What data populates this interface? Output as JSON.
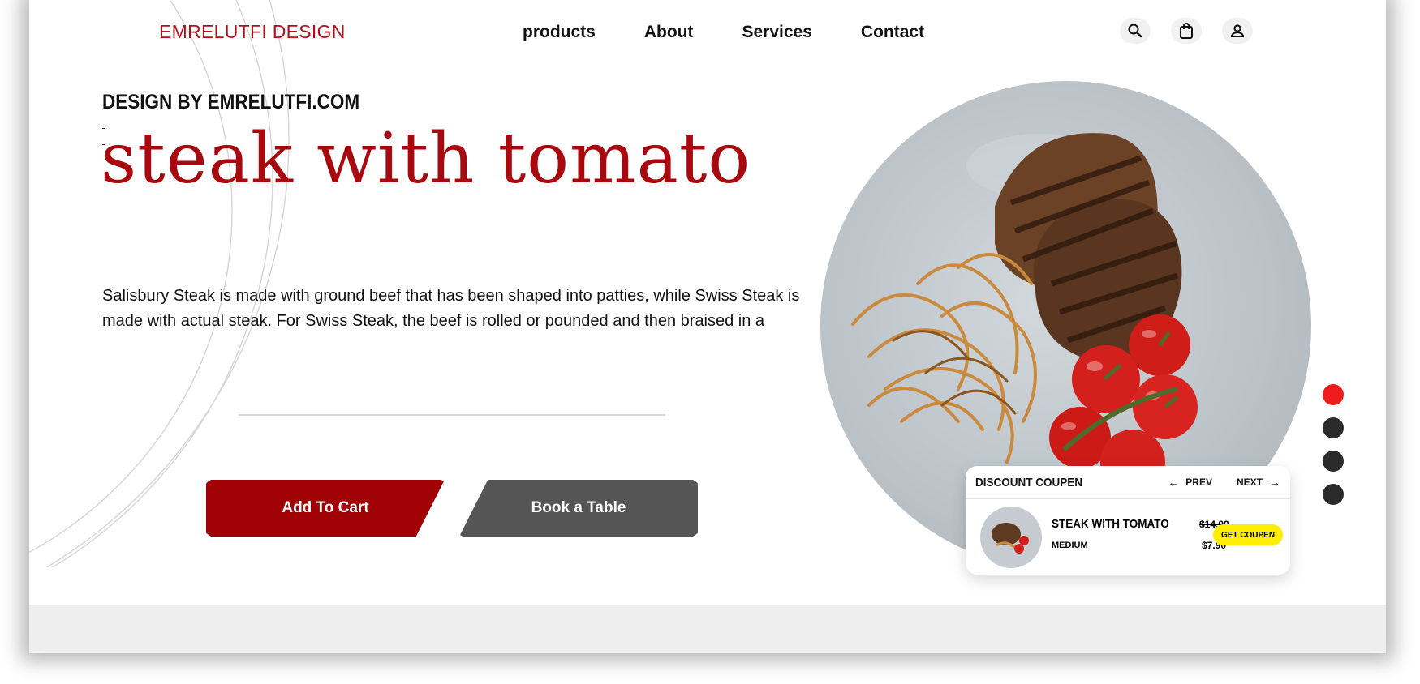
{
  "brand": {
    "logo": "EMRELUTFI DESIGN"
  },
  "nav": {
    "items": [
      "products",
      "About",
      "Services",
      "Contact"
    ]
  },
  "header_icons": [
    "search-icon",
    "bag-icon",
    "user-icon"
  ],
  "hero": {
    "eyebrow": "DESIGN BY EMRELUTFI.COM",
    "title": "steak with tomato",
    "description": "Salisbury Steak is made with ground beef that has been shaped into patties, while Swiss Steak is made with actual steak. For Swiss Steak, the beef is rolled or pounded and then braised in a",
    "add_to_cart": "Add To Cart",
    "book_table": "Book a Table"
  },
  "slider": {
    "count": 4,
    "active_index": 0
  },
  "coupon": {
    "heading": "DISCOUNT COUPEN",
    "prev": "PREV",
    "next": "NEXT",
    "item_name": "STEAK WITH TOMATO",
    "size": "MEDIUM",
    "old_price": "$14.99",
    "new_price": "$7.90",
    "cta": "GET COUPEN"
  },
  "colors": {
    "accent": "#a8090e",
    "button_secondary": "#555555",
    "coupon_button": "#ffee00",
    "slider_active": "#ee1c1c",
    "slider_inactive": "#2b2b2b"
  }
}
